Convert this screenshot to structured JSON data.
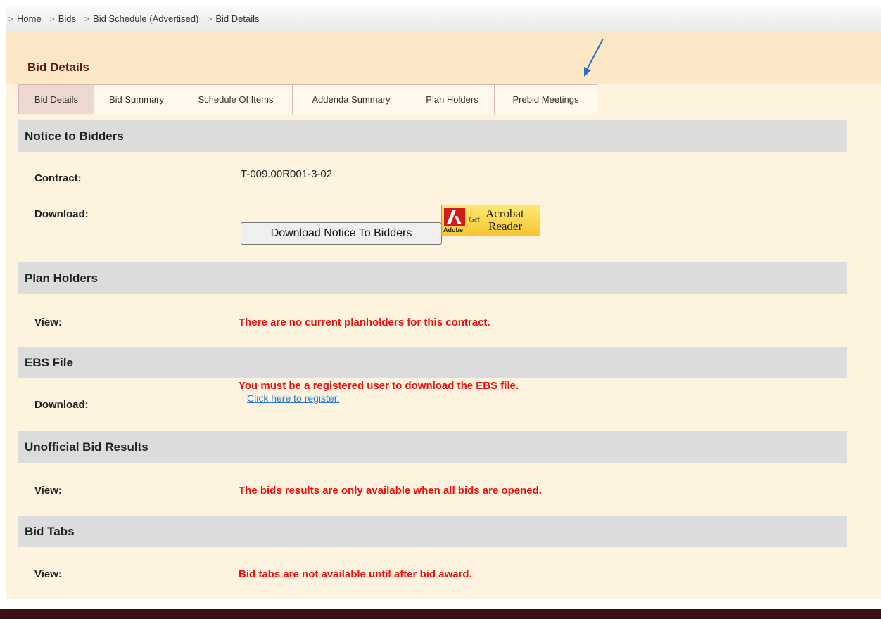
{
  "breadcrumb": [
    {
      "label": "Home"
    },
    {
      "label": "Bids"
    },
    {
      "label": "Bid Schedule (Advertised)"
    },
    {
      "label": "Bid Details"
    }
  ],
  "page_title": "Bid Details",
  "tabs": [
    {
      "label": "Bid Details",
      "active": true
    },
    {
      "label": "Bid Summary"
    },
    {
      "label": "Schedule Of Items"
    },
    {
      "label": "Addenda Summary"
    },
    {
      "label": "Plan Holders"
    },
    {
      "label": "Prebid Meetings"
    }
  ],
  "notice": {
    "title": "Notice to Bidders",
    "contract_label": "Contract:",
    "contract_value": "T-009.00R001-3-02",
    "download_label": "Download:",
    "download_button": "Download Notice To Bidders",
    "acrobat": {
      "get": "Get",
      "acrobat": "Acrobat",
      "reader": "Reader",
      "adobe": "Adobe"
    }
  },
  "plan_holders": {
    "title": "Plan Holders",
    "view_label": "View:",
    "message": "There are no current planholders for this contract."
  },
  "ebs_file": {
    "title": "EBS File",
    "download_label": "Download:",
    "message": "You must be a registered user to download the EBS file.",
    "register_link": "Click here to register."
  },
  "unofficial_results": {
    "title": "Unofficial Bid Results",
    "view_label": "View:",
    "message": "The bids results are only available when all bids are opened."
  },
  "bid_tabs": {
    "title": "Bid Tabs",
    "view_label": "View:",
    "message": "Bid tabs are not available until after bid award."
  },
  "colors": {
    "accent_red": "#f01010",
    "title_maroon": "#5a1a1a",
    "panel_bg": "#fdf3df",
    "footer": "#3a1016",
    "link": "#2a78d8"
  }
}
